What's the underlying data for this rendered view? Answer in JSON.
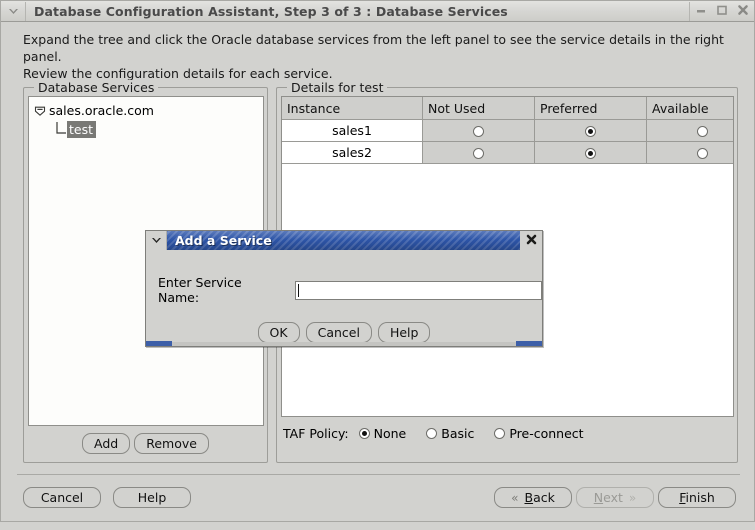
{
  "window": {
    "title": "Database Configuration Assistant, Step 3 of 3 : Database Services",
    "menu_icon": "chevron-down-icon",
    "controls": {
      "minimize": "minimize-icon",
      "maximize": "maximize-icon",
      "close": "close-icon"
    }
  },
  "header": {
    "line1": "Expand the tree and click the Oracle database services from the left panel to see the service details in the right panel.",
    "line2": "Review the configuration details for each service."
  },
  "services_panel": {
    "title": "Database Services",
    "tree": {
      "root": {
        "label": "sales.oracle.com",
        "toggle_icon": "collapse-minus-icon",
        "expanded": true
      },
      "child": {
        "label": "test",
        "selected": true,
        "elbow_icon": "tree-elbow-icon"
      }
    },
    "buttons": {
      "add": "Add",
      "remove": "Remove"
    }
  },
  "details_panel": {
    "title": "Details for test",
    "table": {
      "columns": [
        "Instance",
        "Not Used",
        "Preferred",
        "Available"
      ],
      "rows": [
        {
          "instance": "sales1",
          "selection": "Preferred"
        },
        {
          "instance": "sales2",
          "selection": "Preferred"
        }
      ]
    },
    "taf": {
      "label": "TAF Policy:",
      "options": [
        "None",
        "Basic",
        "Pre-connect"
      ],
      "selected": "None"
    }
  },
  "footer": {
    "cancel": "Cancel",
    "help": "Help",
    "back": "Back",
    "back_mnemonic": "B",
    "back_icon": "chevron-left-double-icon",
    "next": "Next",
    "next_mnemonic": "N",
    "next_icon": "chevron-right-double-icon",
    "next_disabled": true,
    "finish": "Finish",
    "finish_mnemonic": "F"
  },
  "dialog": {
    "title": "Add a Service",
    "menu_icon": "chevron-down-icon",
    "close_icon": "close-icon",
    "field_label": "Enter Service Name:",
    "field_value": "",
    "field_placeholder": "",
    "buttons": {
      "ok": "OK",
      "cancel": "Cancel",
      "help": "Help"
    }
  },
  "colors": {
    "background": "#d2d2cf",
    "dialog_title": "#2d55a8",
    "selection": "#797975",
    "field_white": "#ffffff"
  }
}
